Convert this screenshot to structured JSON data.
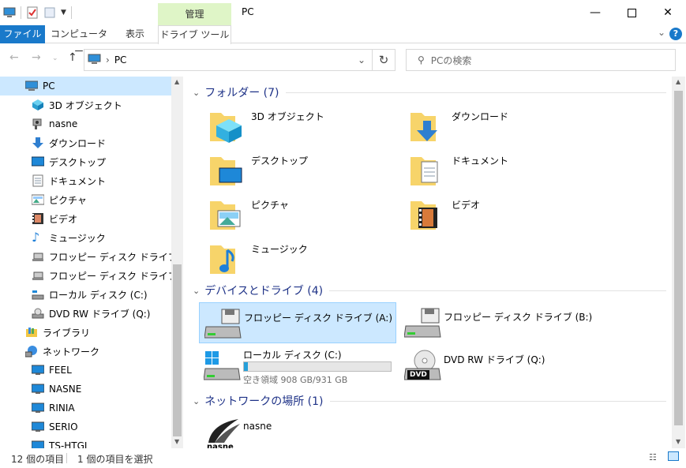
{
  "window": {
    "title": "PC",
    "context_group": "管理"
  },
  "ribbon": {
    "tabs": [
      "ファイル",
      "コンピューター",
      "表示",
      "ドライブ ツール"
    ]
  },
  "address": {
    "location": "PC"
  },
  "search": {
    "placeholder": "PCの検索"
  },
  "sidebar": {
    "items": [
      {
        "label": "PC",
        "icon": "pc-icon"
      },
      {
        "label": "3D オブジェクト",
        "icon": "3d-objects-icon"
      },
      {
        "label": "nasne",
        "icon": "nasne-icon"
      },
      {
        "label": "ダウンロード",
        "icon": "download-icon"
      },
      {
        "label": "デスクトップ",
        "icon": "desktop-icon"
      },
      {
        "label": "ドキュメント",
        "icon": "documents-icon"
      },
      {
        "label": "ピクチャ",
        "icon": "pictures-icon"
      },
      {
        "label": "ビデオ",
        "icon": "videos-icon"
      },
      {
        "label": "ミュージック",
        "icon": "music-icon"
      },
      {
        "label": "フロッピー ディスク ドライブ (A:)",
        "icon": "floppy-icon"
      },
      {
        "label": "フロッピー ディスク ドライブ (B:)",
        "icon": "floppy-icon"
      },
      {
        "label": "ローカル ディスク (C:)",
        "icon": "local-disk-icon"
      },
      {
        "label": "DVD RW ドライブ (Q:)",
        "icon": "dvd-icon"
      },
      {
        "label": "ライブラリ",
        "icon": "library-icon"
      },
      {
        "label": "ネットワーク",
        "icon": "network-icon"
      },
      {
        "label": "FEEL",
        "icon": "computer-icon"
      },
      {
        "label": "NASNE",
        "icon": "computer-icon"
      },
      {
        "label": "RINIA",
        "icon": "computer-icon"
      },
      {
        "label": "SERIO",
        "icon": "computer-icon"
      },
      {
        "label": "TS-HTGL",
        "icon": "computer-icon"
      }
    ]
  },
  "groups": {
    "folders": {
      "title": "フォルダー (7)",
      "items": [
        "3D オブジェクト",
        "ダウンロード",
        "デスクトップ",
        "ドキュメント",
        "ピクチャ",
        "ビデオ",
        "ミュージック"
      ]
    },
    "devices": {
      "title": "デバイスとドライブ (4)",
      "items": [
        {
          "label": "フロッピー ディスク ドライブ (A:)"
        },
        {
          "label": "フロッピー ディスク ドライブ (B:)"
        },
        {
          "label": "ローカル ディスク (C:)",
          "free": "空き領域 908 GB/931 GB",
          "used_fraction": 0.025
        },
        {
          "label": "DVD RW ドライブ (Q:)",
          "badge": "DVD"
        }
      ]
    },
    "network": {
      "title": "ネットワークの場所 (1)",
      "items": [
        {
          "label": "nasne",
          "logo_text": "nasne"
        }
      ]
    }
  },
  "status": {
    "count": "12 個の項目",
    "selected": "1 個の項目を選択"
  },
  "colors": {
    "accent": "#1979ca",
    "context_tab": "#dff5c7",
    "selection": "#cce8ff",
    "group_header": "#1e3287"
  }
}
